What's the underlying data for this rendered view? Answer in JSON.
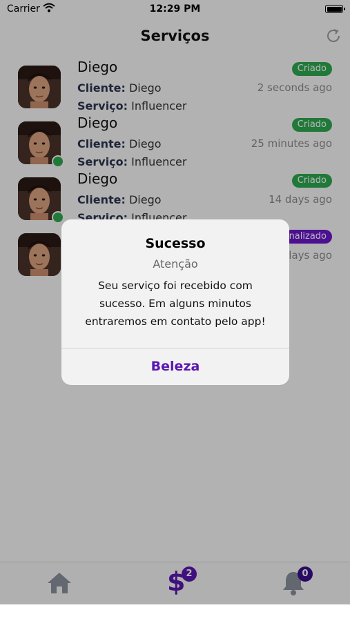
{
  "status_bar": {
    "carrier": "Carrier",
    "time": "12:29 PM"
  },
  "nav": {
    "title": "Serviços",
    "refresh_icon": "refresh-icon"
  },
  "colors": {
    "green": "#2fa84f",
    "purple": "#6a17c9",
    "accent_purple": "#5b17b0",
    "tab_icon_gray": "#8a8f9c"
  },
  "services": [
    {
      "name": "Diego",
      "client_label": "Cliente:",
      "client": "Diego",
      "service_label": "Serviço:",
      "service": "Influencer",
      "status": "Criado",
      "status_color": "#2fa84f",
      "time_ago": "2 seconds ago",
      "online": false
    },
    {
      "name": "Diego",
      "client_label": "Cliente:",
      "client": "Diego",
      "service_label": "Serviço:",
      "service": "Influencer",
      "status": "Criado",
      "status_color": "#2fa84f",
      "time_ago": "25 minutes ago",
      "online": true
    },
    {
      "name": "Diego",
      "client_label": "Cliente:",
      "client": "Diego",
      "service_label": "Serviço:",
      "service": "Influencer",
      "status": "Criado",
      "status_color": "#2fa84f",
      "time_ago": "14 days ago",
      "online": true
    },
    {
      "name": "",
      "client_label": "",
      "client": "",
      "service_label": "",
      "service": "",
      "status": "nalizado",
      "status_color": "#6a17c9",
      "time_ago": "lays ago",
      "online": false
    }
  ],
  "tabs": [
    {
      "icon": "home-icon",
      "badge": null
    },
    {
      "icon": "dollar-icon",
      "badge": "2"
    },
    {
      "icon": "bell-icon",
      "badge": "0"
    }
  ],
  "alert": {
    "title": "Sucesso",
    "subtitle": "Atenção",
    "message": "Seu serviço foi recebido com sucesso. Em alguns minutos entraremos em contato pelo app!",
    "button": "Beleza"
  }
}
